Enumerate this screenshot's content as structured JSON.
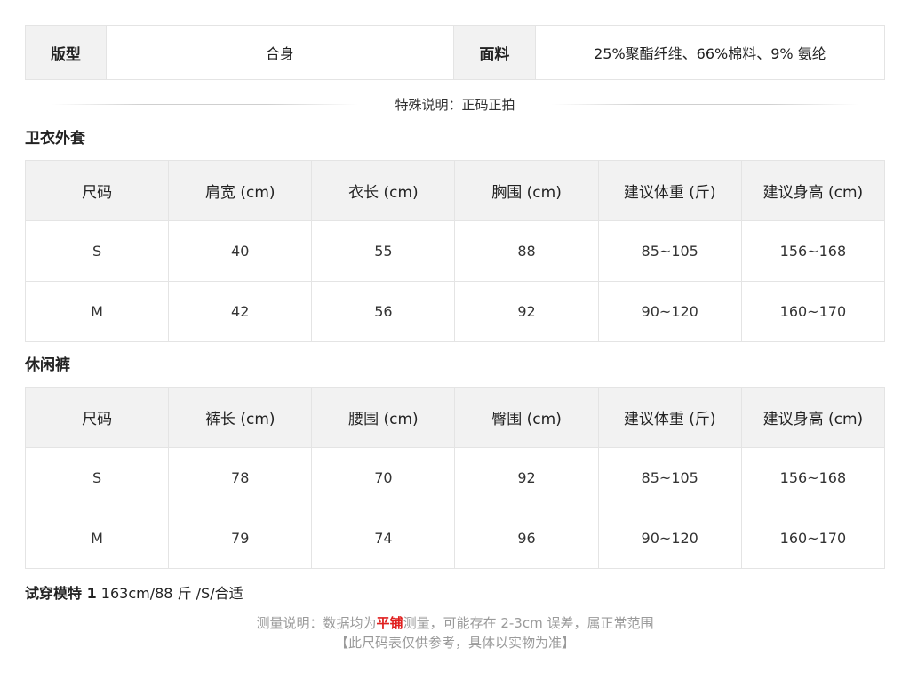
{
  "info": {
    "fit_label": "版型",
    "fit_value": "合身",
    "fabric_label": "面料",
    "fabric_value": "25%聚酯纤维、66%棉料、9% 氨纶"
  },
  "special_note": "特殊说明：正码正拍",
  "hoodie": {
    "title": "卫衣外套",
    "headers": [
      "尺码",
      "肩宽 (cm)",
      "衣长 (cm)",
      "胸围 (cm)",
      "建议体重 (斤)",
      "建议身高 (cm)"
    ],
    "rows": [
      [
        "S",
        "40",
        "55",
        "88",
        "85~105",
        "156~168"
      ],
      [
        "M",
        "42",
        "56",
        "92",
        "90~120",
        "160~170"
      ]
    ]
  },
  "pants": {
    "title": "休闲裤",
    "headers": [
      "尺码",
      "裤长 (cm)",
      "腰围 (cm)",
      "臀围 (cm)",
      "建议体重 (斤)",
      "建议身高 (cm)"
    ],
    "rows": [
      [
        "S",
        "78",
        "70",
        "92",
        "85~105",
        "156~168"
      ],
      [
        "M",
        "79",
        "74",
        "96",
        "90~120",
        "160~170"
      ]
    ]
  },
  "model": {
    "label": "试穿模特 1",
    "value": " 163cm/88 斤 /S/合适"
  },
  "notes": {
    "line1_prefix": "测量说明：数据均为",
    "line1_highlight": "平铺",
    "line1_suffix": "测量，可能存在 2-3cm 误差，属正常范围",
    "line2": "【此尺码表仅供参考，具体以实物为准】"
  },
  "colors": {
    "highlight": "#e0201f",
    "header_bg": "#f2f2f2",
    "border": "#e4e4e4"
  }
}
